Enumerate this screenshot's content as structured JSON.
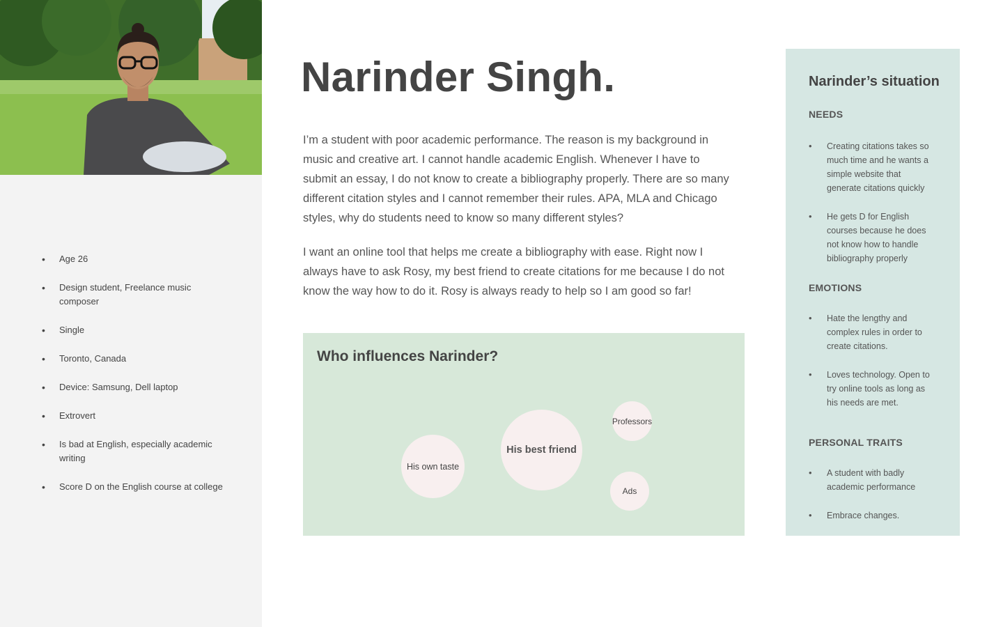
{
  "persona": {
    "name": "Narinder Singh.",
    "bio": [
      "I’m a student with poor academic performance. The reason is my background in music and creative art. I cannot handle academic English. Whenever I have to submit an essay, I do not know to create a bibliography properly. There are so many different citation styles and I cannot remember their rules. APA, MLA and Chicago styles, why do students need to know so many different styles?",
      "I want an online tool that helps me create a bibliography with ease. Right now I always have to ask Rosy, my best friend to create citations for me because I do not know the way how to do it. Rosy is always ready to help so I am good so far!"
    ],
    "facts": [
      "Age 26",
      "Design student, Freelance music composer",
      "Single",
      "Toronto, Canada",
      "Device: Samsung, Dell laptop",
      "Extrovert",
      "Is bad at English, especially academic writing",
      "Score D on the English course at college"
    ]
  },
  "influences": {
    "title": "Who influences Narinder?",
    "bubbles": [
      "His own taste",
      "His best friend",
      "Professors",
      "Ads"
    ]
  },
  "situation": {
    "title": "Narinder’s situation",
    "needs_title": "NEEDS",
    "needs": [
      "Creating citations takes so much time and he wants a simple website that generate citations quickly",
      "He gets D for English courses because he does not know how to handle bibliography properly"
    ],
    "emotions_title": "EMOTIONS",
    "emotions": [
      "Hate the lengthy and complex rules in order to create citations.",
      "Loves technology. Open to try online tools as long as his needs are met."
    ],
    "traits_title": "PERSONAL TRAITS",
    "traits": [
      "A student with badly academic performance",
      "Embrace changes."
    ]
  },
  "colors": {
    "left_panel": "#f3f3f3",
    "influence_bg": "#d7e8d9",
    "situation_bg": "#d6e7e3",
    "bubble": "#f8efef"
  }
}
